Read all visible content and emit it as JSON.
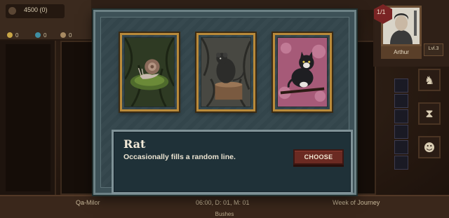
{
  "resources": {
    "gold": "4500 (0)",
    "items": [
      {
        "icon": "coin-icon",
        "value": "0",
        "color": "#c9a646"
      },
      {
        "icon": "gem-icon",
        "value": "0",
        "color": "#3f8fa3"
      },
      {
        "icon": "resource-icon",
        "value": "0",
        "color": "#a88a62"
      }
    ]
  },
  "player": {
    "lives": "1/1",
    "name": "Arthur",
    "level": "Lvl.3"
  },
  "bottom_bar": {
    "location": "Qa-Milor",
    "time": "06:00, D: 01, M: 01",
    "week": "Week of Journey",
    "terrain": "Bushes"
  },
  "modal": {
    "cards": [
      {
        "name": "snail-card",
        "background": "#2f3a24"
      },
      {
        "name": "rat-card",
        "background": "#44443f"
      },
      {
        "name": "cat-card",
        "background": "#a85a78"
      }
    ],
    "selected": {
      "title": "Rat",
      "description": "Occasionally fills a random line."
    },
    "choose_label": "CHOOSE"
  },
  "colors": {
    "modal_bg": "#3d5157",
    "card_border": "#b98a3a",
    "button": "#6b2a22"
  }
}
